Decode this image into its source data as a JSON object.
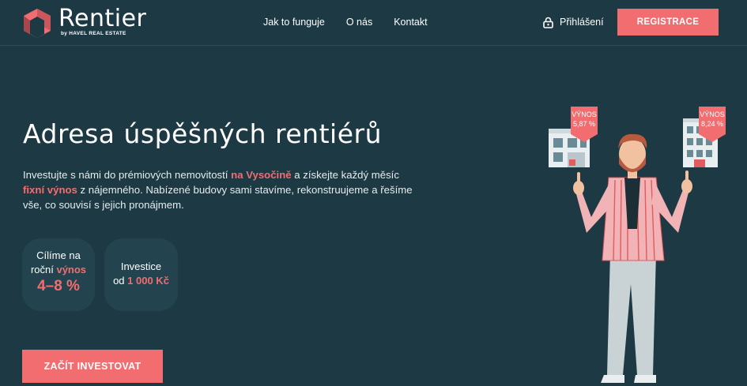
{
  "brand": {
    "name": "Rentier",
    "sub": "by HAVEL REAL ESTATE"
  },
  "nav": [
    "Jak to funguje",
    "O nás",
    "Kontakt"
  ],
  "login": "Přihlášení",
  "register": "REGISTRACE",
  "hero": {
    "title": "Adresa úspěšných rentiérů",
    "t1": "Investujte s námi do prémiových nemovitostí ",
    "t2": "na Vysočině",
    "t3": " a získejte každý měsíc ",
    "t4": "fixní výnos",
    "t5": " z nájemného. Nabízené budovy sami stavíme, rekonstruujeme a řešíme vše, co souvisí s jejich pronájmem."
  },
  "stats": {
    "s1_line1": "Cílíme na",
    "s1_line2a": "roční ",
    "s1_line2b": "výnos",
    "s1_value": "4–8 %",
    "s2_line1": "Investice",
    "s2_line2a": "od ",
    "s2_line2b": "1 000 Kč"
  },
  "cta": "ZAČÍT INVESTOVAT",
  "badges": [
    {
      "label": "VÝNOS",
      "value": "5,87 %"
    },
    {
      "label": "VÝNOS",
      "value": "8,24 %"
    }
  ],
  "colors": {
    "background": "#1d3a44",
    "accent": "#f26d70",
    "card": "#23444e"
  }
}
